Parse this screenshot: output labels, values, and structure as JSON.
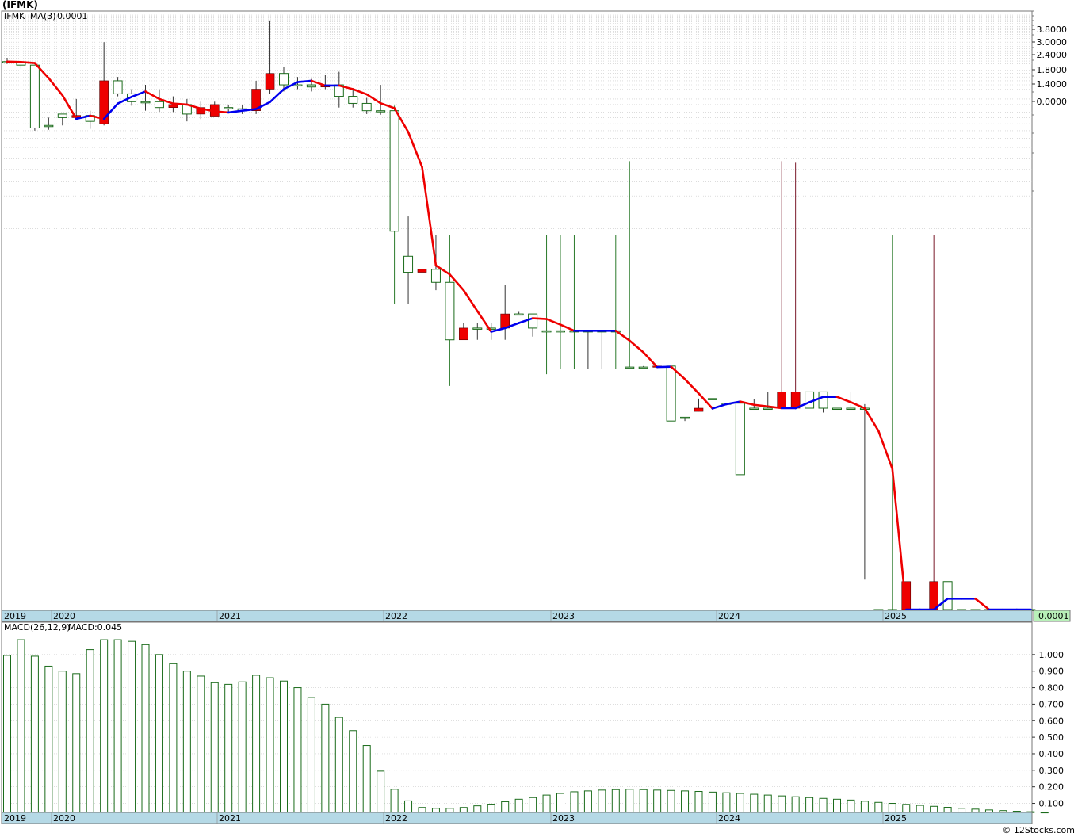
{
  "title": "(IFMK)",
  "footer": "© 12Stocks.com",
  "colors": {
    "up": "#1a6b1a",
    "down": "#ee0000",
    "ma_up": "#0000ee",
    "ma_down": "#ee0000",
    "macd_bar": "#1a6b1a",
    "axis_band": "#b5d9e6",
    "last_value_bg": "#b8f0b8"
  },
  "chart_data": [
    {
      "type": "candlestick",
      "name": "price",
      "legend": {
        "symbol": "IFMK",
        "ma_label": "MA(3)",
        "ma_value": "0.0001"
      },
      "last_value": "0.0001",
      "yscale": "log",
      "y_tick_labels": [
        "3.8000",
        "3.0000",
        "2.4000",
        "1.8000",
        "1.4000",
        "0.0000"
      ],
      "x_labels": [
        "2019",
        "2020",
        "2021",
        "2022",
        "2023",
        "2024",
        "2025"
      ],
      "ohlc": [
        [
          2.05,
          2.22,
          2.0,
          2.08
        ],
        [
          1.96,
          2.08,
          1.85,
          2.05
        ],
        [
          0.67,
          1.96,
          0.64,
          1.96
        ],
        [
          0.7,
          0.8,
          0.65,
          0.7
        ],
        [
          0.8,
          0.85,
          0.7,
          0.85
        ],
        [
          0.83,
          1.1,
          0.77,
          0.8
        ],
        [
          0.75,
          0.9,
          0.66,
          0.83
        ],
        [
          1.5,
          2.9,
          0.7,
          0.72
        ],
        [
          1.2,
          1.6,
          1.15,
          1.5
        ],
        [
          1.05,
          1.3,
          0.98,
          1.2
        ],
        [
          1.05,
          1.4,
          0.9,
          1.05
        ],
        [
          0.95,
          1.3,
          0.88,
          1.05
        ],
        [
          1.0,
          1.15,
          0.88,
          0.95
        ],
        [
          0.85,
          1.1,
          0.75,
          1.0
        ],
        [
          0.95,
          1.05,
          0.78,
          0.85
        ],
        [
          1.0,
          1.05,
          0.82,
          0.82
        ],
        [
          0.93,
          1.0,
          0.87,
          0.95
        ],
        [
          0.9,
          0.99,
          0.85,
          0.93
        ],
        [
          1.3,
          1.5,
          0.85,
          0.9
        ],
        [
          1.7,
          4.2,
          1.2,
          1.3
        ],
        [
          1.4,
          1.9,
          1.25,
          1.7
        ],
        [
          1.4,
          1.6,
          1.3,
          1.4
        ],
        [
          1.35,
          1.55,
          1.25,
          1.4
        ],
        [
          1.4,
          1.65,
          1.3,
          1.35
        ],
        [
          1.15,
          1.75,
          0.95,
          1.4
        ],
        [
          1.02,
          1.3,
          0.95,
          1.15
        ],
        [
          0.9,
          1.12,
          0.85,
          1.02
        ],
        [
          0.9,
          1.4,
          0.84,
          0.9
        ],
        [
          0.115,
          0.98,
          0.033,
          0.9
        ],
        [
          0.057,
          0.148,
          0.033,
          0.075
        ],
        [
          0.06,
          0.153,
          0.045,
          0.057
        ],
        [
          0.048,
          0.108,
          0.042,
          0.06
        ],
        [
          0.018,
          0.108,
          0.0082,
          0.048
        ],
        [
          0.022,
          0.024,
          0.018,
          0.018
        ],
        [
          0.022,
          0.024,
          0.018,
          0.022
        ],
        [
          0.022,
          0.024,
          0.018,
          0.022
        ],
        [
          0.028,
          0.046,
          0.018,
          0.022
        ],
        [
          0.028,
          0.029,
          0.028,
          0.028
        ],
        [
          0.022,
          0.028,
          0.019,
          0.028
        ],
        [
          0.021,
          0.108,
          0.01,
          0.021
        ],
        [
          0.021,
          0.108,
          0.011,
          0.021
        ],
        [
          0.021,
          0.108,
          0.011,
          0.021
        ],
        [
          0.021,
          0.021,
          0.011,
          0.021
        ],
        [
          0.021,
          0.021,
          0.011,
          0.021
        ],
        [
          0.021,
          0.108,
          0.011,
          0.021
        ],
        [
          0.0113,
          0.38,
          0.011,
          0.0113
        ],
        [
          0.0113,
          0.0115,
          0.0113,
          0.0113
        ],
        [
          0.0115,
          0.0115,
          0.0113,
          0.0113
        ],
        [
          0.0045,
          0.0115,
          0.0045,
          0.0115
        ],
        [
          0.0048,
          0.0048,
          0.0045,
          0.0048
        ],
        [
          0.0056,
          0.0066,
          0.0053,
          0.0053
        ],
        [
          0.0066,
          0.0066,
          0.0066,
          0.0066
        ],
        [
          0.0061,
          0.0061,
          0.0061,
          0.0061
        ],
        [
          0.0018,
          0.0061,
          0.0018,
          0.0061
        ],
        [
          0.0056,
          0.0065,
          0.0056,
          0.0056
        ],
        [
          0.0056,
          0.0074,
          0.0056,
          0.0056
        ],
        [
          0.0074,
          0.38,
          0.0056,
          0.0056
        ],
        [
          0.0074,
          0.37,
          0.0056,
          0.0056
        ],
        [
          0.0056,
          0.0074,
          0.0056,
          0.0074
        ],
        [
          0.0056,
          0.0074,
          0.0052,
          0.0074
        ],
        [
          0.0056,
          0.0056,
          0.0056,
          0.0056
        ],
        [
          0.0056,
          0.0074,
          0.0055,
          0.0056
        ],
        [
          0.0056,
          0.006,
          0.0003,
          0.0056
        ],
        [
          0.00018,
          0.00018,
          0.00018,
          0.00018
        ],
        [
          0.00018,
          0.108,
          0.00018,
          0.00018
        ],
        [
          0.00029,
          0.00029,
          0.00018,
          0.00018
        ],
        [
          0.00018,
          0.00018,
          0.00018,
          0.00018
        ],
        [
          0.00029,
          0.108,
          0.00018,
          0.00018
        ],
        [
          0.00018,
          0.00029,
          0.00018,
          0.00029
        ],
        [
          0.00018,
          0.00018,
          0.00018,
          0.00018
        ],
        [
          0.00018,
          0.00018,
          0.00018,
          0.00018
        ],
        [
          0.00018,
          0.00018,
          0.00018,
          0.00018
        ],
        [
          0.00018,
          0.00018,
          0.00018,
          0.00018
        ],
        [
          0.00018,
          0.00018,
          0.00018,
          0.00018
        ],
        [
          0.00018,
          0.00018,
          0.00018,
          0.00018
        ]
      ]
    },
    {
      "type": "bar",
      "name": "macd",
      "legend": {
        "label": "MACD(26,12,9)",
        "value_label": "MACD:0.045"
      },
      "y_tick_labels": [
        "1.000",
        "0.900",
        "0.800",
        "0.700",
        "0.600",
        "0.500",
        "0.400",
        "0.300",
        "0.200",
        "0.100"
      ],
      "ylim": [
        0.045,
        1.1
      ],
      "x_labels": [
        "2019",
        "2020",
        "2021",
        "2022",
        "2023",
        "2024",
        "2025"
      ],
      "values": [
        0.995,
        1.09,
        0.99,
        0.93,
        0.9,
        0.885,
        1.03,
        1.09,
        1.09,
        1.08,
        1.06,
        1.0,
        0.945,
        0.9,
        0.87,
        0.83,
        0.82,
        0.835,
        0.875,
        0.86,
        0.84,
        0.8,
        0.74,
        0.7,
        0.62,
        0.54,
        0.45,
        0.295,
        0.185,
        0.115,
        0.075,
        0.07,
        0.07,
        0.075,
        0.085,
        0.095,
        0.11,
        0.125,
        0.135,
        0.15,
        0.16,
        0.17,
        0.175,
        0.18,
        0.183,
        0.185,
        0.183,
        0.18,
        0.178,
        0.175,
        0.172,
        0.168,
        0.164,
        0.16,
        0.155,
        0.15,
        0.145,
        0.14,
        0.135,
        0.13,
        0.125,
        0.12,
        0.113,
        0.106,
        0.1,
        0.094,
        0.088,
        0.082,
        0.076,
        0.07,
        0.065,
        0.06,
        0.056,
        0.052,
        0.049,
        0.047
      ]
    }
  ]
}
